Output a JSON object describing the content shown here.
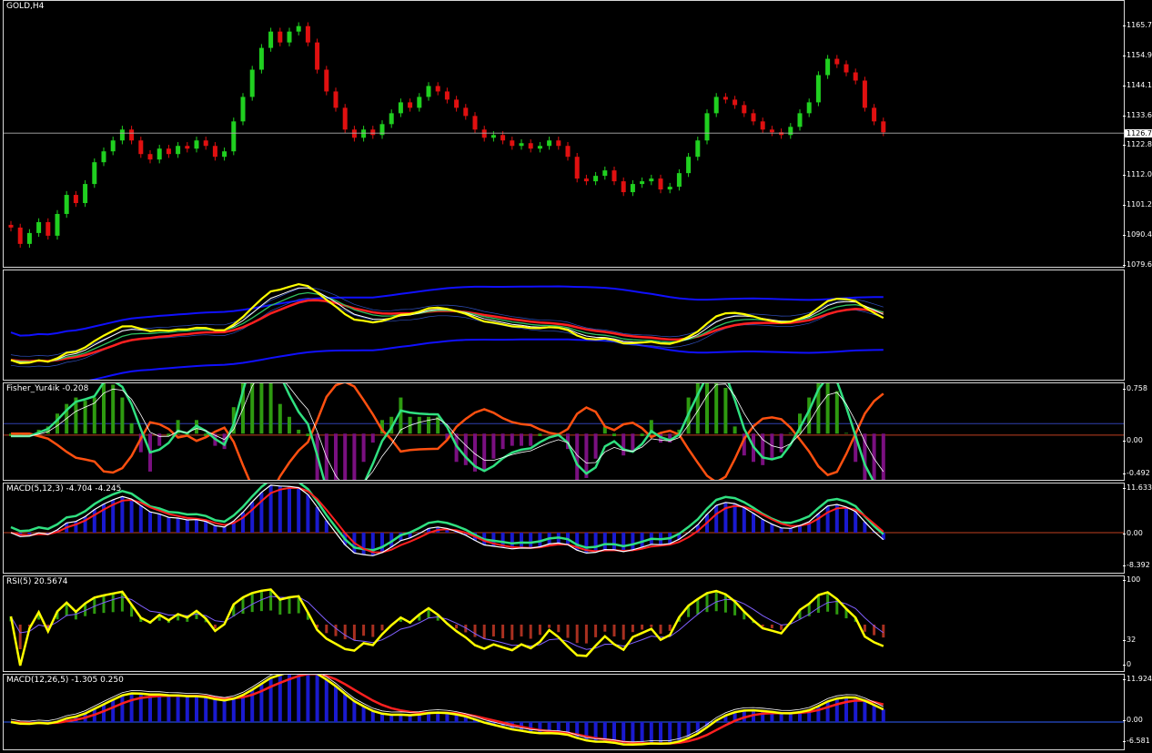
{
  "window": {
    "title": "GOLD,H4"
  },
  "panes": [
    {
      "id": "price",
      "title": "GOLD,H4",
      "ticks": [
        "1165.7",
        "1154.9",
        "1144.1",
        "1133.6",
        "1126.7",
        "1122.8",
        "1112.0",
        "1101.2",
        "1090.4",
        "1079.6"
      ],
      "current_price": "1126.7"
    },
    {
      "id": "envelopes",
      "title": "",
      "ticks": []
    },
    {
      "id": "fisher",
      "title": "Fisher_Yur4ik -0.208",
      "ticks": [
        "0.758",
        "0.00",
        "-0.492"
      ]
    },
    {
      "id": "macd_fast",
      "title": "MACD(5,12,3) -4.704 -4.245",
      "ticks": [
        "11.633",
        "0.00",
        "-8.392"
      ]
    },
    {
      "id": "rsi",
      "title": "RSI(5) 20.5674",
      "ticks": [
        "100",
        "32",
        "0"
      ]
    },
    {
      "id": "macd_slow",
      "title": "MACD(12,26,5) -1.305 0.250",
      "ticks": [
        "11.924",
        "0.00",
        "-6.581"
      ]
    }
  ],
  "colors": {
    "bull": "#20d020",
    "bear": "#e01010",
    "yellow": "#ffff00",
    "red": "#ff2020",
    "blue": "#1010ff",
    "green": "#30e080",
    "orange": "#ff5010",
    "white": "#ffffff",
    "hist_green": "#2e9a10",
    "hist_purple": "#7a1080",
    "hist_blue": "#1a1acf",
    "hist_red": "#a83020"
  },
  "chart_data": [
    {
      "type": "candlestick",
      "title": "GOLD,H4",
      "ylim": [
        1079.6,
        1170
      ],
      "close": [
        1092,
        1086,
        1090,
        1094,
        1089,
        1097,
        1104,
        1101,
        1108,
        1116,
        1120,
        1124,
        1128,
        1124,
        1119,
        1117,
        1121,
        1119,
        1122,
        1121,
        1124,
        1122,
        1118,
        1120,
        1131,
        1140,
        1150,
        1158,
        1164,
        1160,
        1164,
        1166,
        1160,
        1150,
        1142,
        1136,
        1128,
        1125,
        1128,
        1126,
        1130,
        1134,
        1138,
        1136,
        1140,
        1144,
        1142,
        1139,
        1136,
        1133,
        1128,
        1125,
        1126,
        1124,
        1122,
        1123,
        1121,
        1122,
        1124,
        1122,
        1118,
        1110,
        1109,
        1111,
        1113,
        1109,
        1105,
        1108,
        1109,
        1110,
        1106,
        1107,
        1112,
        1118,
        1124,
        1134,
        1140,
        1139,
        1137,
        1134,
        1131,
        1128,
        1127,
        1126,
        1129,
        1134,
        1138,
        1148,
        1154,
        1152,
        1149,
        1146,
        1136,
        1131,
        1127
      ]
    }
  ]
}
